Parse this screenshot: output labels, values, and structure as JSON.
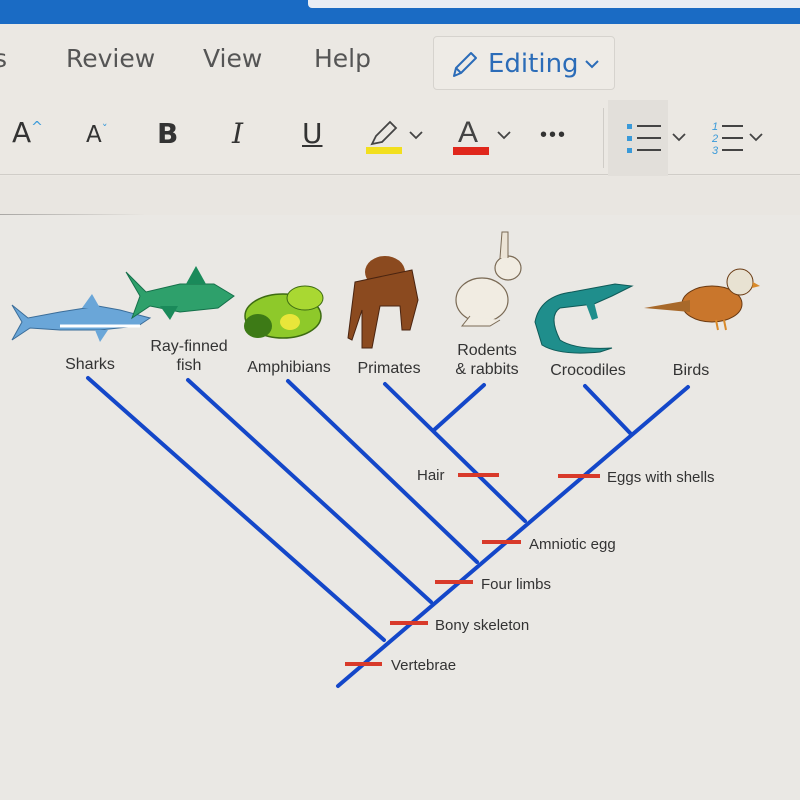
{
  "ribbon": {
    "tabs": [
      {
        "label": "s"
      },
      {
        "label": "Review"
      },
      {
        "label": "View"
      },
      {
        "label": "Help"
      }
    ],
    "mode_button": {
      "label": "Editing",
      "icon": "pencil-icon"
    }
  },
  "toolbar": {
    "grow_font": "A",
    "shrink_font": "A",
    "bold": "B",
    "italic": "I",
    "underline": "U",
    "more": "•••",
    "highlight_color": "#f4e01a",
    "font_color": "#e0271c",
    "numbering_digits": [
      "1",
      "2",
      "3"
    ]
  },
  "cladogram": {
    "taxa": [
      {
        "label": "Sharks",
        "lines": [
          "Sharks"
        ]
      },
      {
        "label": "Ray-finned fish",
        "lines": [
          "Ray-finned",
          "fish"
        ]
      },
      {
        "label": "Amphibians",
        "lines": [
          "Amphibians"
        ]
      },
      {
        "label": "Primates",
        "lines": [
          "Primates"
        ]
      },
      {
        "label": "Rodents & rabbits",
        "lines": [
          "Rodents",
          "& rabbits"
        ]
      },
      {
        "label": "Crocodiles",
        "lines": [
          "Crocodiles"
        ]
      },
      {
        "label": "Birds",
        "lines": [
          "Birds"
        ]
      }
    ],
    "traits": [
      {
        "label": "Vertebrae"
      },
      {
        "label": "Bony skeleton"
      },
      {
        "label": "Four limbs"
      },
      {
        "label": "Amniotic egg"
      },
      {
        "label": "Hair"
      },
      {
        "label": "Eggs with shells"
      }
    ],
    "branch_color": "#1447c9",
    "trait_color": "#d83a2a"
  }
}
